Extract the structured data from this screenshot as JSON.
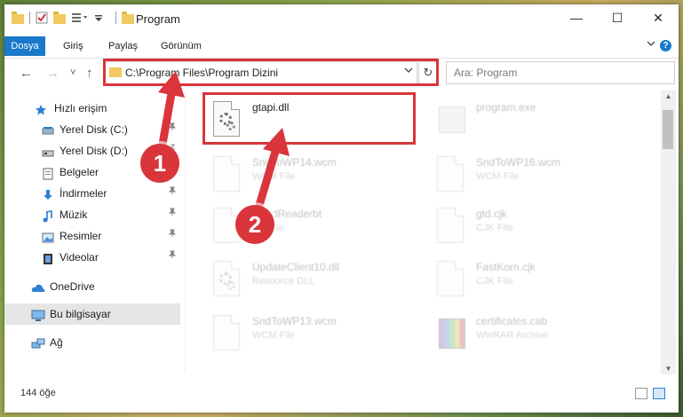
{
  "window": {
    "title": "Program",
    "controls": {
      "minimize": "—",
      "maximize": "☐",
      "close": "✕"
    }
  },
  "ribbon": {
    "tabs": [
      {
        "label": "Dosya",
        "active": true
      },
      {
        "label": "Giriş"
      },
      {
        "label": "Paylaş"
      },
      {
        "label": "Görünüm"
      }
    ],
    "expand_icon": "chevron-down-icon",
    "help": "?"
  },
  "navigation": {
    "back": "←",
    "forward": "→",
    "recent": "˅",
    "up": "↑",
    "address": "C:\\Program Files\\Program Dizini",
    "refresh": "↻",
    "search_placeholder": "Ara: Program"
  },
  "sidebar": {
    "items": [
      {
        "label": "Hızlı erişim",
        "icon": "star-icon"
      },
      {
        "label": "Yerel Disk (C:)",
        "icon": "drive-icon",
        "pinned": true
      },
      {
        "label": "Yerel Disk (D:)",
        "icon": "drive-icon",
        "pinned": true
      },
      {
        "label": "Belgeler",
        "icon": "documents-icon",
        "pinned": true
      },
      {
        "label": "İndirmeler",
        "icon": "download-icon",
        "pinned": true
      },
      {
        "label": "Müzik",
        "icon": "music-icon",
        "pinned": true
      },
      {
        "label": "Resimler",
        "icon": "pictures-icon",
        "pinned": true
      },
      {
        "label": "Videolar",
        "icon": "videos-icon",
        "pinned": true
      },
      {
        "label": "OneDrive",
        "icon": "cloud-icon"
      },
      {
        "label": "Bu bilgisayar",
        "icon": "computer-icon",
        "selected": true
      },
      {
        "label": "Ağ",
        "icon": "network-icon"
      }
    ],
    "pin_glyph": "📌"
  },
  "files": [
    {
      "name": "gtapi.dll",
      "type": "",
      "icon": "dll-icon",
      "highlighted": true
    },
    {
      "name": "program.exe",
      "type": "",
      "icon": "exe-icon"
    },
    {
      "name": "SndToWP14.wcm",
      "type": "WCM File",
      "icon": "file-icon"
    },
    {
      "name": "SndToWP16.wcm",
      "type": "WCM File",
      "icon": "file-icon"
    },
    {
      "name": "ReadReaderbt",
      "type": "Txt File",
      "icon": "file-icon"
    },
    {
      "name": "gtd.cjk",
      "type": "CJK File",
      "icon": "file-icon"
    },
    {
      "name": "UpdateClient10.dll",
      "type": "Resource DLL",
      "icon": "dll-icon"
    },
    {
      "name": "FastKorn.cjk",
      "type": "CJK File",
      "icon": "file-icon"
    },
    {
      "name": "SndToWP13.wcm",
      "type": "WCM File",
      "icon": "file-icon"
    },
    {
      "name": "certificates.cab",
      "type": "WinRAR Archive",
      "icon": "archive-icon"
    }
  ],
  "status": {
    "item_count": "144 öğe"
  },
  "annotations": {
    "step1": "1",
    "step2": "2",
    "color": "#d9353a"
  }
}
